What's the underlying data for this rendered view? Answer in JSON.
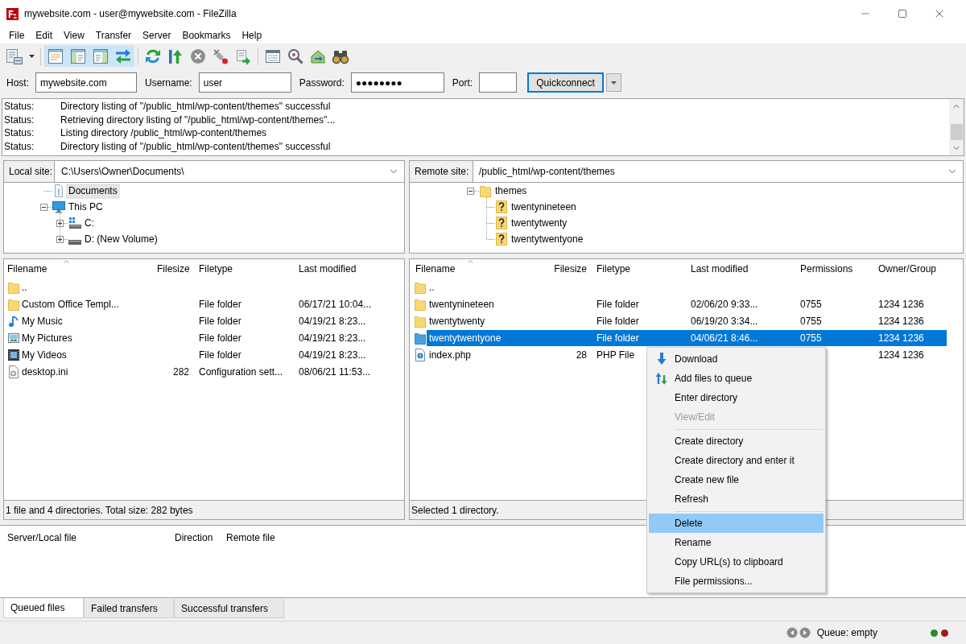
{
  "window": {
    "title": "mywebsite.com - user@mywebsite.com - FileZilla"
  },
  "menu": [
    "File",
    "Edit",
    "View",
    "Transfer",
    "Server",
    "Bookmarks",
    "Help"
  ],
  "toolbar": [
    {
      "kind": "sitemanager",
      "pressed": false
    },
    {
      "kind": "separator"
    },
    {
      "kind": "messagelog",
      "pressed": true
    },
    {
      "kind": "localtree",
      "pressed": true
    },
    {
      "kind": "remotetree",
      "pressed": true
    },
    {
      "kind": "queue",
      "pressed": true
    },
    {
      "kind": "separator"
    },
    {
      "kind": "refresh",
      "pressed": false
    },
    {
      "kind": "processqueue",
      "pressed": false
    },
    {
      "kind": "cancel",
      "pressed": false
    },
    {
      "kind": "disconnect",
      "pressed": false
    },
    {
      "kind": "reconnect",
      "pressed": false
    },
    {
      "kind": "separator"
    },
    {
      "kind": "filter",
      "pressed": false
    },
    {
      "kind": "compare",
      "pressed": false
    },
    {
      "kind": "syncbrowse",
      "pressed": false
    },
    {
      "kind": "find",
      "pressed": false
    }
  ],
  "quickconnect": {
    "fields": [
      {
        "label": "Host:",
        "value": "mywebsite.com"
      },
      {
        "label": "Username:",
        "value": "user"
      },
      {
        "label": "Password:",
        "value": "●●●●●●●●"
      },
      {
        "label": "Port:"
      }
    ],
    "button": "Quickconnect"
  },
  "log": [
    {
      "label": "Status:",
      "message": "Directory listing of \"/public_html/wp-content/themes\" successful"
    },
    {
      "label": "Status:",
      "message": "Retrieving directory listing of \"/public_html/wp-content/themes\"..."
    },
    {
      "label": "Status:",
      "message": "Listing directory /public_html/wp-content/themes"
    },
    {
      "label": "Status:",
      "message": "Directory listing of \"/public_html/wp-content/themes\" successful"
    }
  ],
  "local": {
    "site_label": "Local site:",
    "path": "C:\\Users\\Owner\\Documents\\",
    "tree": [
      {
        "label": "Documents",
        "kind": "documents",
        "selected": true
      },
      {
        "label": "This PC",
        "kind": "computer",
        "selected": false,
        "expanded": true,
        "children": [
          {
            "label": "C:",
            "kind": "system-drive",
            "selected": false,
            "expanded": false
          },
          {
            "label": "D: (New Volume)",
            "kind": "drive",
            "selected": false,
            "expanded": false
          }
        ]
      }
    ],
    "columns": [
      "Filename",
      "Filesize",
      "Filetype",
      "Last modified"
    ],
    "rows": [
      {
        "kind": "folder",
        "name": "..",
        "selected": false
      },
      {
        "kind": "folder",
        "name": "Custom Office Templ...",
        "type": "File folder",
        "modified": "06/17/21 10:04...",
        "selected": false
      },
      {
        "kind": "music",
        "name": "My Music",
        "type": "File folder",
        "modified": "04/19/21 8:23...",
        "selected": false
      },
      {
        "kind": "pictures",
        "name": "My Pictures",
        "type": "File folder",
        "modified": "04/19/21 8:23...",
        "selected": false
      },
      {
        "kind": "videos",
        "name": "My Videos",
        "type": "File folder",
        "modified": "04/19/21 8:23...",
        "selected": false
      },
      {
        "kind": "settings-file",
        "name": "desktop.ini",
        "size": "282",
        "type": "Configuration sett...",
        "modified": "08/06/21 11:53...",
        "selected": false
      }
    ],
    "status": "1 file and 4 directories. Total size: 282 bytes"
  },
  "remote": {
    "site_label": "Remote site:",
    "path": "/public_html/wp-content/themes",
    "tree": [
      {
        "label": "themes",
        "kind": "folder",
        "selected": false,
        "expanded": true,
        "children": [
          {
            "label": "twentynineteen",
            "kind": "unknown",
            "selected": false
          },
          {
            "label": "twentytwenty",
            "kind": "unknown",
            "selected": false
          },
          {
            "label": "twentytwentyone",
            "kind": "unknown",
            "selected": false
          }
        ]
      }
    ],
    "columns": [
      "Filename",
      "Filesize",
      "Filetype",
      "Last modified",
      "Permissions",
      "Owner/Group"
    ],
    "rows": [
      {
        "kind": "folder",
        "name": "..",
        "selected": false
      },
      {
        "kind": "folder",
        "name": "twentynineteen",
        "type": "File folder",
        "modified": "02/06/20 9:33...",
        "permissions": "0755",
        "owner": "1234 1236",
        "selected": false
      },
      {
        "kind": "folder",
        "name": "twentytwenty",
        "type": "File folder",
        "modified": "06/19/20 3:34...",
        "permissions": "0755",
        "owner": "1234 1236",
        "selected": false
      },
      {
        "kind": "folder",
        "name": "twentytwentyone",
        "type": "File folder",
        "modified": "04/06/21 8:46...",
        "permissions": "0755",
        "owner": "1234 1236",
        "selected": true
      },
      {
        "kind": "php",
        "name": "index.php",
        "size": "28",
        "type": "PHP File",
        "owner": "1234 1236",
        "selected": false
      }
    ],
    "status": "Selected 1 directory."
  },
  "queue": {
    "columns": [
      "Server/Local file",
      "Direction",
      "Remote file"
    ]
  },
  "queue_tabs": [
    {
      "label": "Queued files",
      "selected": true
    },
    {
      "label": "Failed transfers",
      "selected": false
    },
    {
      "label": "Successful transfers",
      "selected": false
    }
  ],
  "status_bar": {
    "queue": "Queue: empty",
    "indicators": [
      {
        "color": "#2e8b2e"
      },
      {
        "color": "#a01818"
      }
    ]
  },
  "context_menu": {
    "items": [
      {
        "kind": "download",
        "label": "Download",
        "disabled": false,
        "selected": false
      },
      {
        "kind": "queue",
        "label": "Add files to queue",
        "disabled": false,
        "selected": false
      },
      {
        "kind": "plain",
        "label": "Enter directory",
        "disabled": false,
        "selected": false
      },
      {
        "kind": "plain",
        "label": "View/Edit",
        "disabled": true,
        "selected": false
      },
      {
        "kind": "separator"
      },
      {
        "kind": "plain",
        "label": "Create directory",
        "disabled": false,
        "selected": false
      },
      {
        "kind": "plain",
        "label": "Create directory and enter it",
        "disabled": false,
        "selected": false
      },
      {
        "kind": "plain",
        "label": "Create new file",
        "disabled": false,
        "selected": false
      },
      {
        "kind": "plain",
        "label": "Refresh",
        "disabled": false,
        "selected": false
      },
      {
        "kind": "separator"
      },
      {
        "kind": "plain",
        "label": "Delete",
        "disabled": false,
        "selected": true
      },
      {
        "kind": "plain",
        "label": "Rename",
        "disabled": false,
        "selected": false
      },
      {
        "kind": "plain",
        "label": "Copy URL(s) to clipboard",
        "disabled": false,
        "selected": false
      },
      {
        "kind": "plain",
        "label": "File permissions...",
        "disabled": false,
        "selected": false
      }
    ]
  }
}
